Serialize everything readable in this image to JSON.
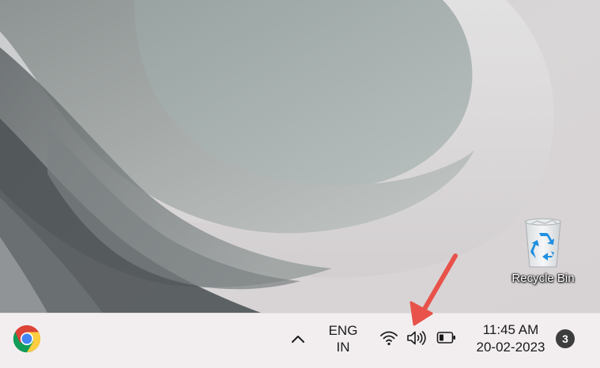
{
  "desktop": {
    "icons": [
      {
        "label": "Recycle Bin",
        "icon": "recycle-bin-icon"
      }
    ]
  },
  "taskbar": {
    "pinned_apps": [
      {
        "name": "Google Chrome",
        "icon": "chrome-icon"
      }
    ],
    "tray": {
      "overflow_icon": "chevron-up-icon",
      "language": {
        "line1": "ENG",
        "line2": "IN"
      },
      "quick_settings": [
        {
          "icon": "wifi-icon"
        },
        {
          "icon": "speaker-volume-icon"
        },
        {
          "icon": "battery-icon"
        }
      ],
      "clock": {
        "time": "11:45 AM",
        "date": "20-02-2023"
      },
      "notification_count": "3"
    }
  },
  "annotation": {
    "type": "arrow",
    "target": "speaker-volume-icon",
    "color": "#e8524a"
  },
  "colors": {
    "taskbar_bg": "#f2eef0",
    "accent_arrow": "#e8524a",
    "badge_bg": "#3d3d3d"
  }
}
